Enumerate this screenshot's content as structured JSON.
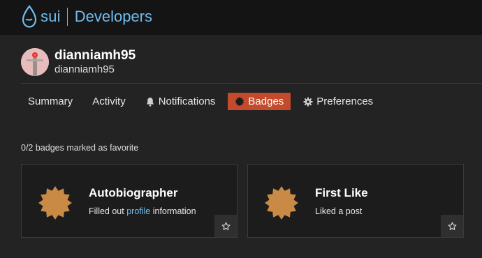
{
  "header": {
    "brand": "sui",
    "section": "Developers",
    "brand_color": "#6fbcf0"
  },
  "profile": {
    "username": "dianniamh95",
    "handle": "dianniamh95",
    "avatar_icon": "user-avatar"
  },
  "nav": {
    "items": [
      {
        "label": "Summary",
        "icon": null
      },
      {
        "label": "Activity",
        "icon": null
      },
      {
        "label": "Notifications",
        "icon": "bell-icon"
      },
      {
        "label": "Badges",
        "icon": "badge-icon",
        "active": true
      },
      {
        "label": "Preferences",
        "icon": "gear-icon"
      }
    ],
    "active_color": "#c44a2c"
  },
  "badges": {
    "favorite_summary": "0/2 badges marked as favorite",
    "items": [
      {
        "name": "Autobiographer",
        "description_before": "Filled out ",
        "description_link": "profile",
        "description_after": " information",
        "icon": "bronze-badge-icon",
        "color": "#c98a45"
      },
      {
        "name": "First Like",
        "description": "Liked a post",
        "icon": "bronze-badge-icon",
        "color": "#c98a45"
      }
    ]
  }
}
